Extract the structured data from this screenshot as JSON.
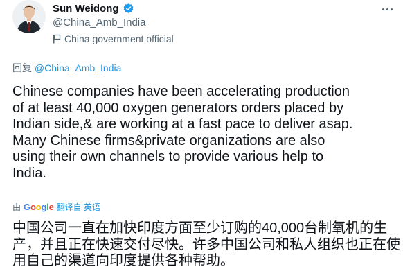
{
  "author": {
    "name": "Sun Weidong",
    "handle": "@China_Amb_India",
    "label": "China government official"
  },
  "reply": {
    "prefix": "回复",
    "mention": "@China_Amb_India"
  },
  "tweet": {
    "text": "Chinese companies have been accelerating production\nof at least 40,000 oxygen generators orders placed by\nIndian side,& are working at a fast pace to deliver asap.\nMany Chinese firms&private organizations are also\nusing their own channels to provide various help to\nIndia."
  },
  "translation": {
    "by": "由",
    "google": [
      "G",
      "o",
      "o",
      "g",
      "l",
      "e"
    ],
    "translated_from": "翻译自 英语",
    "text": "中国公司一直在加快印度方面至少订购的40,000台制氧机的生产，并且正在快速交付尽快。许多中国公司和私人组织也正在使用自己的渠道向印度提供各种帮助。"
  },
  "colors": {
    "verified": "#1d9bf0",
    "link": "#1b95e0",
    "secondary_text": "#536471"
  }
}
